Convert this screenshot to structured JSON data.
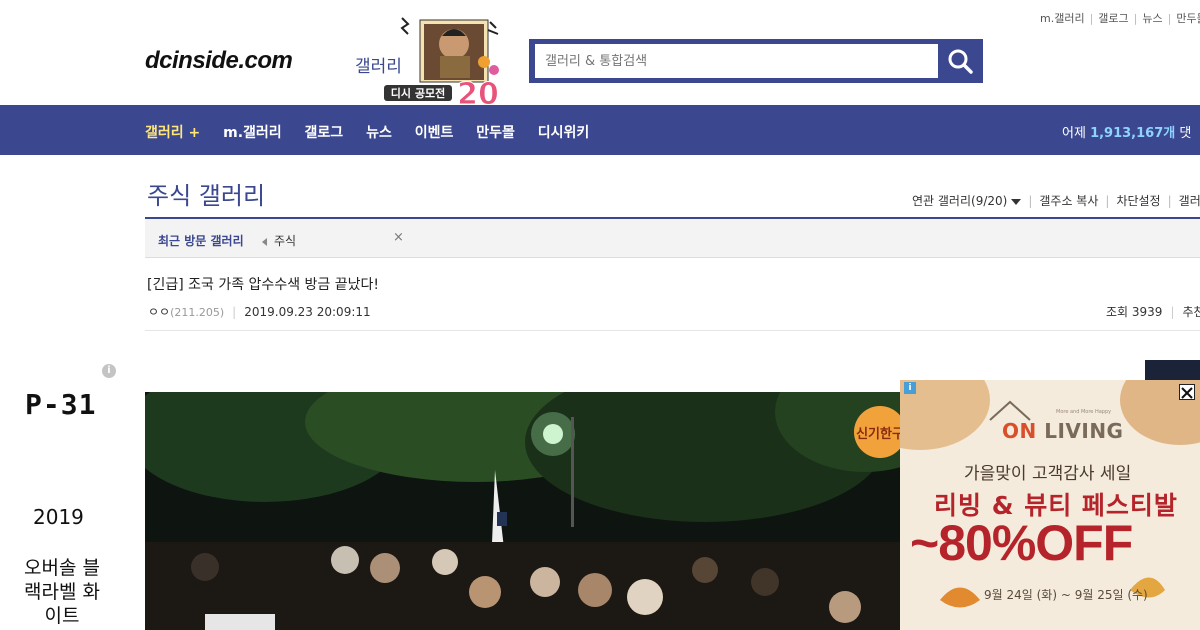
{
  "util": {
    "links": [
      "m.갤러리",
      "갤로그",
      "뉴스",
      "만두몰"
    ]
  },
  "logo": {
    "text": "dcinside.com",
    "sub": "갤러리"
  },
  "mascot": {
    "badge": "디시 공모전",
    "number": "20"
  },
  "search": {
    "placeholder": "갤러리 & 통합검색"
  },
  "nav": {
    "items": [
      "갤러리 +",
      "m.갤러리",
      "갤로그",
      "뉴스",
      "이벤트",
      "만두몰",
      "디시위키"
    ],
    "right_prefix": "어제 ",
    "right_count": "1,913,167개",
    "right_suffix": " 댓"
  },
  "gallery": {
    "title": "주식 갤러리",
    "related": "연관 갤러리(9/20)",
    "copy_addr": "갤주소 복사",
    "block": "차단설정",
    "more": "갤러"
  },
  "recent": {
    "label": "최근 방문 갤러리",
    "item": "주식",
    "close": "×"
  },
  "post": {
    "title": "[긴급] 조국 가족 압수수색 방금 끝났다!",
    "author": "ㅇㅇ",
    "ip": "(211.205)",
    "datetime": "2019.09.23 20:09:11",
    "views": "조회 3939",
    "rec": "추천"
  },
  "left_ad": {
    "info": "i",
    "line1": "P-31",
    "line2": "2019",
    "line3": "오버솔 블랙라벨 화이트"
  },
  "photo": {
    "watermark": "신기한구"
  },
  "right_ad": {
    "info": "i",
    "brand_prefix": "ON",
    "brand_suffix": " LIVING",
    "tagline": "More and More Happy",
    "sub": "가을맞이 고객감사 세일",
    "main": "리빙 & 뷰티 페스티발",
    "offer": "~80%OFF",
    "date": "9월 24일 (화) ~ 9월 25일 (수)"
  },
  "colors": {
    "brand": "#3b4890",
    "nav_highlight": "#ffe67a",
    "ad_red": "#b4242a"
  }
}
